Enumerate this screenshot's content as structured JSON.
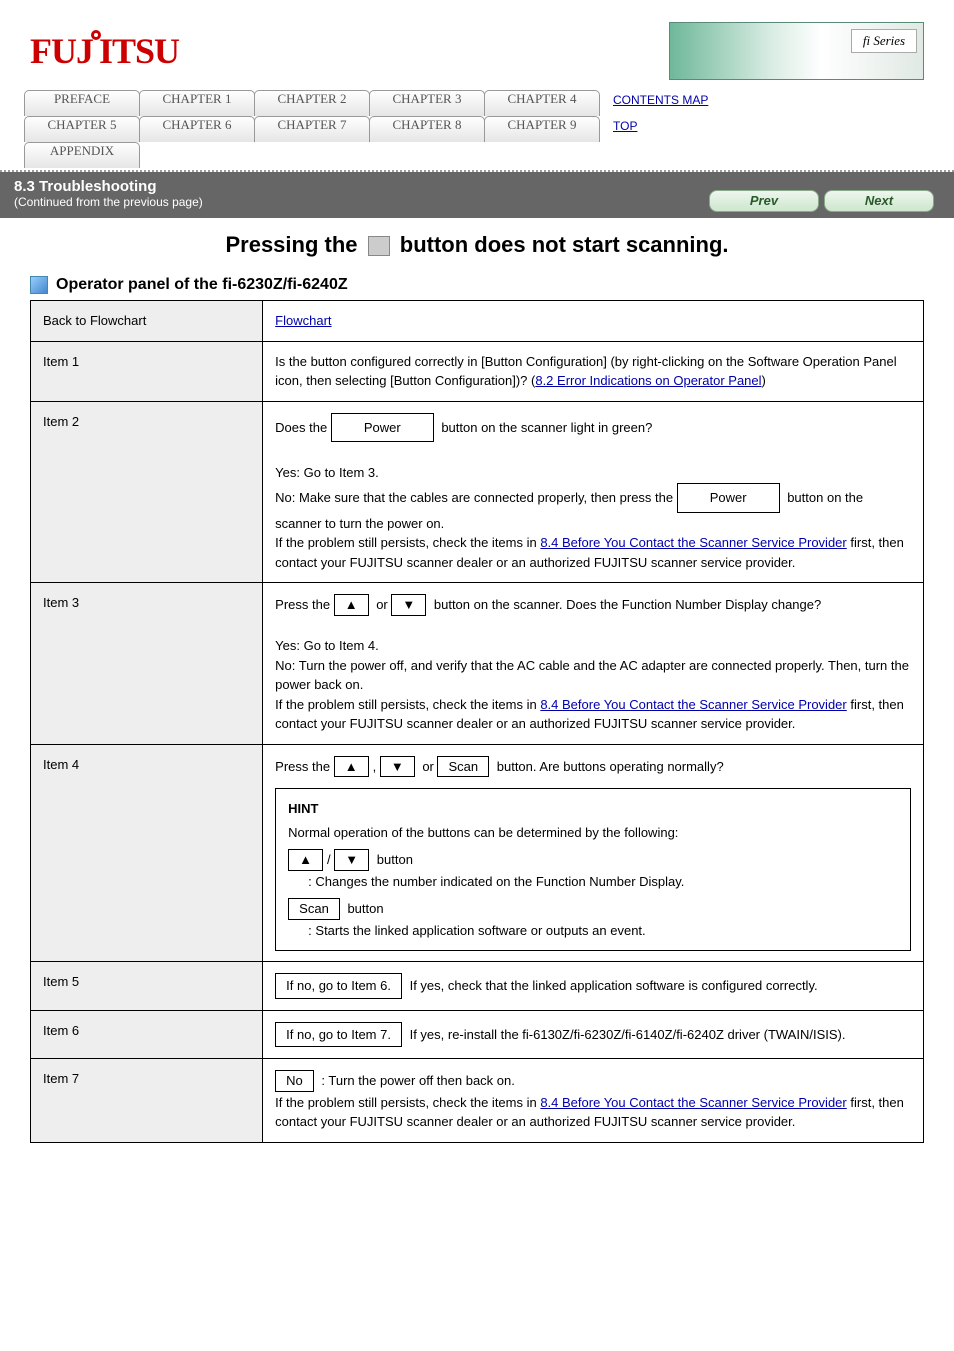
{
  "logo": "FUJITSU",
  "badge": "fi Series",
  "tabs": {
    "row1": [
      "PREFACE",
      "CHAPTER 1",
      "CHAPTER 2",
      "CHAPTER 3",
      "CHAPTER 4"
    ],
    "row2": [
      "CHAPTER 5",
      "CHAPTER 6",
      "CHAPTER 7",
      "CHAPTER 8",
      "CHAPTER 9"
    ],
    "row3": [
      "APPENDIX"
    ]
  },
  "side_links": [
    "CONTENTS MAP",
    "TOP"
  ],
  "secbar_line1": "8.3 Troubleshooting",
  "secbar_line2": "(Continued from the previous page)",
  "prev": "Prev",
  "next": "Next",
  "heading_prefix": "Pressing the ",
  "heading_suffix": " button does not start scanning.",
  "heading_icon_name": "Scan",
  "sub": "Operator panel of the fi-6230Z/fi-6240Z",
  "rows": [
    {
      "k": "Back to Flowchart",
      "v_html": "flowlink",
      "flow_text": "Flowchart"
    },
    {
      "k": "Item 1",
      "q": "Is the button configured correctly in [Button Configuration] (by right-clicking on the Software Operation Panel icon, then selecting [Button Configuration])?",
      "link": "8.2 Error Indications on Operator Panel"
    },
    {
      "k": "Item 2",
      "v_prefix": "Does the ",
      "v_suffix": " button on the scanner light in green?",
      "btn": "Power",
      "yes": "Yes",
      "no": "No",
      "no_tail": ": Make sure that the cables are connected properly, then press the ",
      "no_tail2": " button on the scanner to turn the power on.",
      "no_tail3": "If the problem still persists, check the items in ",
      "no_link": "8.4 Before You Contact the Scanner Service Provider",
      "no_tail4": " first, then contact your FUJITSU scanner dealer or an authorized FUJITSU scanner service provider."
    },
    {
      "k": "Item 3",
      "q_prefix": "Press the ",
      "q_mid": " or ",
      "q_suffix": " button on the scanner. Does the Function Number Display change?",
      "btn1": "▲",
      "btn2": "▼",
      "yes": "Yes",
      "no": "No",
      "no_tail": ": Turn the power off, and verify that the AC cable and the AC adapter are connected properly. Then, turn the power back on.",
      "no_tail2": "If the problem still persists, check the items in ",
      "no_link": "8.4 Before You Contact the Scanner Service Provider",
      "no_tail3": " first, then contact your FUJITSU scanner dealer or an authorized FUJITSU scanner service provider."
    },
    {
      "k": "Item 4",
      "q_prefix": "Press the ",
      "q_mid1": ", ",
      "q_mid2": " or ",
      "q_suffix": " button. Are buttons operating normally?",
      "btn1": "▲",
      "btn2": "▼",
      "btn3": "Scan",
      "note_label": "HINT",
      "note_body": "Normal operation of the buttons can be determined by the following:",
      "note_b1_label": "button",
      "note_b1_body": ": Changes the number indicated on the Function Number Display.",
      "note_b2_btn": "Scan",
      "note_b2_label": "button",
      "note_b2_body": ": Starts the linked application software or outputs an event."
    },
    {
      "k": "Item 5",
      "btn": "If no, go to Item 6.",
      "tail": " If yes, check that the linked application software is configured correctly."
    },
    {
      "k": "Item 6",
      "btn": "If no, go to Item 7.",
      "tail": " If yes, re-install the fi-6130Z/fi-6230Z/fi-6140Z/fi-6240Z driver (TWAIN/ISIS)."
    },
    {
      "k": "Item 7",
      "btn": "No",
      "tail": ": Turn the power off then back on.",
      "tail2": "If the problem still persists, check the items in ",
      "link": "8.4 Before You Contact the Scanner Service Provider",
      "tail3": " first, then contact your FUJITSU scanner dealer or an authorized FUJITSU scanner service provider."
    }
  ]
}
